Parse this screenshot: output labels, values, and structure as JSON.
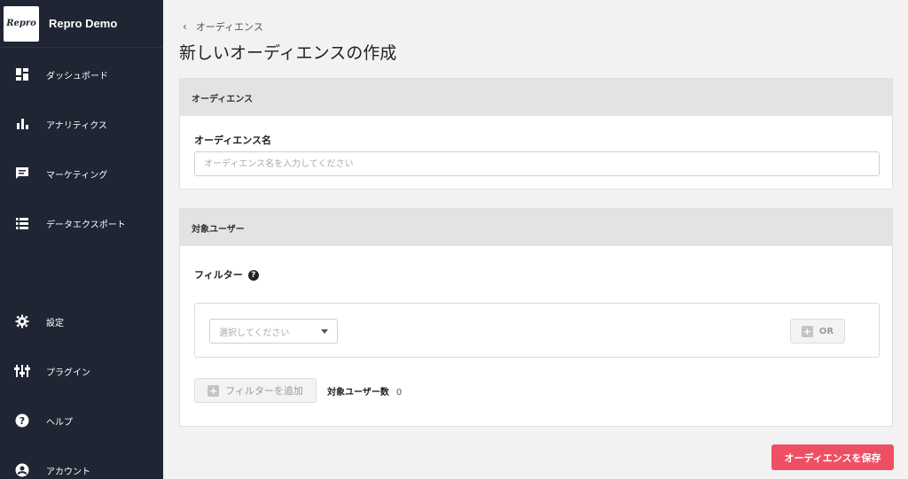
{
  "brand": {
    "logo_text": "Repro",
    "name": "Repro Demo"
  },
  "sidebar": {
    "items": [
      {
        "label": "ダッシュボード",
        "icon": "dashboard-icon"
      },
      {
        "label": "アナリティクス",
        "icon": "bar-chart-icon"
      },
      {
        "label": "マーケティング",
        "icon": "chat-icon"
      },
      {
        "label": "データエクスポート",
        "icon": "list-icon"
      },
      {
        "label": "設定",
        "icon": "gear-icon"
      },
      {
        "label": "プラグイン",
        "icon": "sliders-icon"
      },
      {
        "label": "ヘルプ",
        "icon": "help-icon"
      },
      {
        "label": "アカウント",
        "icon": "account-icon"
      }
    ]
  },
  "breadcrumb": {
    "back_label": "オーディエンス"
  },
  "page": {
    "title": "新しいオーディエンスの作成"
  },
  "audience_card": {
    "header": "オーディエンス",
    "name_label": "オーディエンス名",
    "name_placeholder": "オーディエンス名を入力してください",
    "name_value": ""
  },
  "target_card": {
    "header": "対象ユーザー",
    "filter_label": "フィルター",
    "select_placeholder": "選択してください",
    "or_label": "OR",
    "add_filter_label": "フィルターを追加",
    "count_label": "対象ユーザー数",
    "count_value": "0"
  },
  "actions": {
    "save_label": "オーディエンスを保存"
  },
  "colors": {
    "sidebar_bg": "#1f2533",
    "accent": "#ef4f64"
  }
}
